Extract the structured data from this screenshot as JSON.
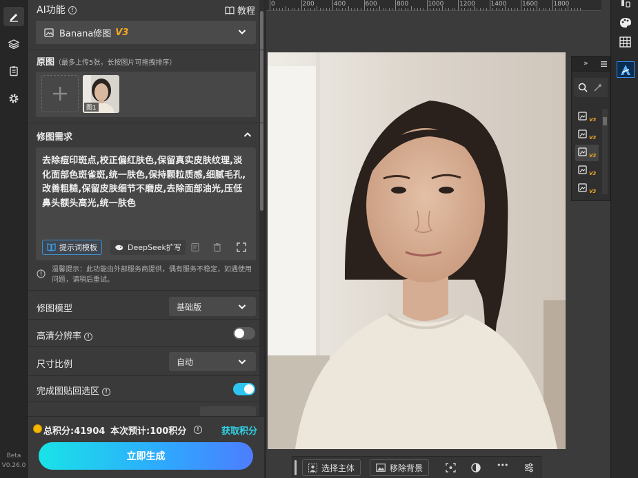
{
  "rail": {
    "version_line1": "Beta",
    "version_line2": "V0.26.0"
  },
  "header": {
    "title": "AI功能",
    "tutorial": "教程"
  },
  "model_select": {
    "name": "Banana修图",
    "version": "V3"
  },
  "source": {
    "title": "原图",
    "hint": "（最多上传5张，长按图片可拖拽排序）",
    "thumb_label": "图1"
  },
  "requirement": {
    "title": "修图需求",
    "text": "去除痘印斑点,校正偏红肤色,保留真实皮肤纹理,淡化面部色斑雀斑,统一肤色,保持颗粒质感,细腻毛孔,改善粗糙,保留皮肤细节不磨皮,去除面部油光,压低鼻头额头高光,统一肤色",
    "template_btn": "提示词模板",
    "deepseek_btn": "DeepSeek扩写"
  },
  "notice": "温馨提示：此功能由外部服务商提供，偶有服务不稳定，如遇使用问题，请稍后重试。",
  "settings": {
    "model_label": "修图模型",
    "model_value": "基础版",
    "hd_label": "高清分辨率",
    "hd_on": false,
    "ratio_label": "尺寸比例",
    "ratio_value": "自动",
    "paste_label": "完成图贴回选区",
    "paste_on": true
  },
  "footer": {
    "points": "总积分:41904",
    "estimate": "本次预计:100积分",
    "get_points": "获取积分",
    "generate": "立即生成"
  },
  "ruler": {
    "labels": [
      "0",
      "200",
      "400",
      "600",
      "800",
      "1000",
      "1200",
      "1400",
      "1600",
      "1800"
    ]
  },
  "canvas_toolbar": {
    "select_subject": "选择主体",
    "remove_bg": "移除背景",
    "more": "•••"
  },
  "toolbox": {
    "badge": "V3"
  },
  "colors": {
    "accent": "#f5a623",
    "link": "#2fd4e8",
    "toggle_on": "#2ec4f0",
    "panel": "#3a3a3a"
  }
}
